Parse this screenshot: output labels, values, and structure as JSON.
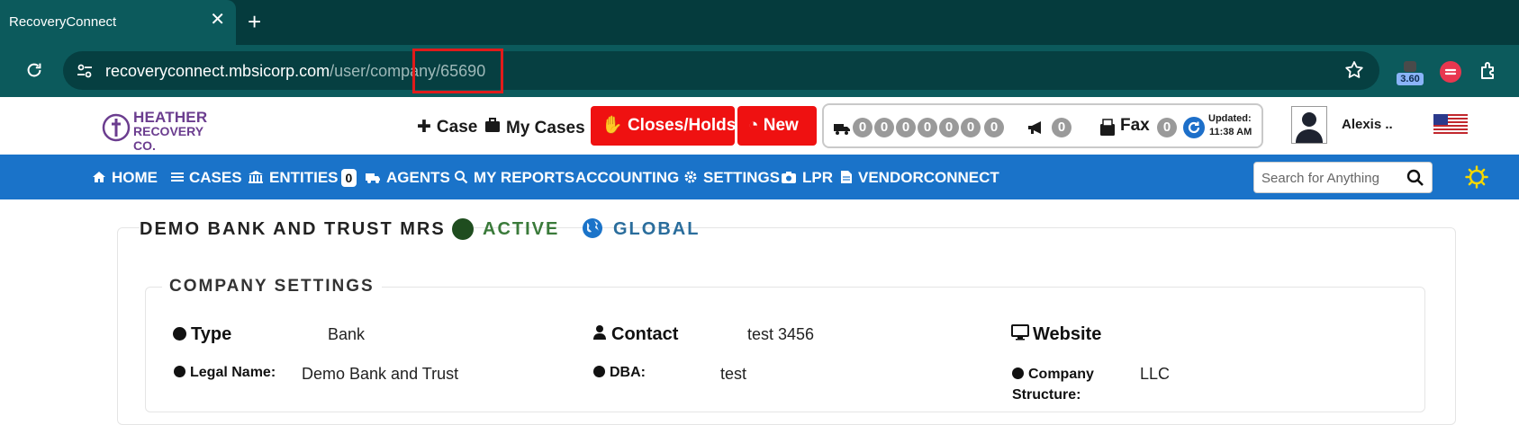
{
  "browser": {
    "tab_title": "RecoveryConnect",
    "tab_close": "✕",
    "new_tab": "+",
    "url_domain": "recoveryconnect.mbsicorp.com",
    "url_path": "/user/company/65690",
    "extension_badge": "3.60"
  },
  "header": {
    "logo_line1": "HEATHER",
    "logo_line2": "RECOVERY CO.",
    "case_label": "Case",
    "my_cases_label": "My Cases",
    "closes_holds_label": "Closes/Holds",
    "new_label": "New",
    "truck_counts": [
      "0",
      "0",
      "0",
      "0",
      "0",
      "0",
      "0"
    ],
    "announce_count": "0",
    "fax_label": "Fax",
    "fax_count": "0",
    "updated_label": "Updated:",
    "updated_time": "11:38 AM",
    "user_name": "Alexis .."
  },
  "nav": {
    "home": "HOME",
    "cases": "CASES",
    "entities": "ENTITIES",
    "entities_count": "0",
    "agents": "AGENTS",
    "my_reports": "MY REPORTS",
    "accounting": "ACCOUNTING",
    "settings": "SETTINGS",
    "lpr": "LPR",
    "vendorconnect": "VENDORCONNECT",
    "search_placeholder": "Search for Anything"
  },
  "company": {
    "name": "DEMO BANK AND TRUST MRS",
    "status": "ACTIVE",
    "scope": "GLOBAL",
    "section_title": "COMPANY SETTINGS",
    "fields": {
      "type_label": "Type",
      "type_value": "Bank",
      "contact_label": "Contact",
      "contact_value": "test 3456",
      "website_label": "Website",
      "legal_name_label": "Legal Name:",
      "legal_name_value": "Demo Bank and Trust",
      "dba_label": "DBA:",
      "dba_value": "test",
      "structure_label_1": "Company",
      "structure_label_2": "Structure:",
      "structure_value": "LLC"
    }
  },
  "colors": {
    "chrome_dark": "#053b3d",
    "chrome_tab": "#0c5a5c",
    "nav_blue": "#1a73c9",
    "red_button": "#ef1111",
    "status_green": "#3a7a3a",
    "global_blue": "#2a6d9c",
    "url_highlight": "#e11b1b"
  }
}
